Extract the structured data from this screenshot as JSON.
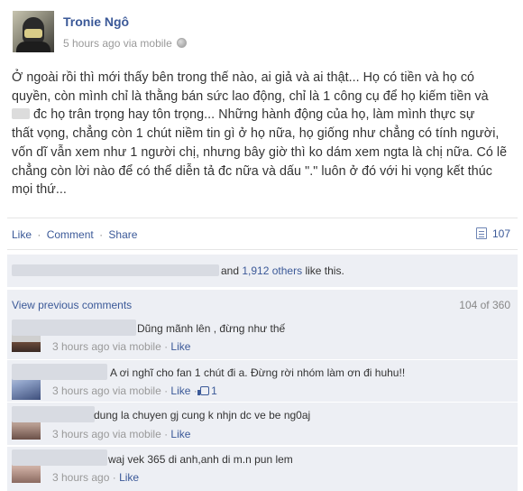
{
  "post": {
    "author": "Tronie Ngô",
    "time": "5 hours ago",
    "via": "via mobile",
    "lines": [
      "Ở ngoài rồi thì mới thấy bên trong thế nào, ai giả và ai thật... Họ có tiền và họ có",
      "quyền, còn mình chỉ là thằng bán sức lao động, chỉ là 1 công cụ để họ kiếm tiền và",
      "đc họ trân trọng hay tôn trọng... Những hành động của họ, làm mình thực sự",
      "thất vọng, chẳng còn 1 chút niềm tin gì ở họ nữa, họ giống như chẳng có tính người,",
      "vốn dĩ vẫn xem như 1 người chị, nhưng bây giờ thì ko dám xem ngta là chị nữa. Có lẽ",
      "chẳng còn lời nào để có thể diễn tả đc nữa và dấu \".\" luôn ở đó với hi vọng kết thúc",
      "mọi thứ..."
    ]
  },
  "actions": {
    "like": "Like",
    "comment": "Comment",
    "share": "Share",
    "sep": "·",
    "share_count": "107"
  },
  "likes": {
    "and": "and",
    "others": "1,912 others",
    "suffix": "like this."
  },
  "comments_header": {
    "view_previous": "View previous comments",
    "count": "104 of 360"
  },
  "comments": [
    {
      "text": "Dũng mãnh lên , đừng như thế",
      "time": "3 hours ago via mobile",
      "like": "Like",
      "likes": ""
    },
    {
      "text": "A ơi nghĩ cho fan 1 chút đi a. Đừng rời nhóm làm ơn đi huhu!!",
      "time": "3 hours ago via mobile",
      "like": "Like",
      "likes": "1"
    },
    {
      "text": "dung la chuyen gj cung k nhjn dc ve be ng0aj",
      "time": "3 hours ago via mobile",
      "like": "Like",
      "likes": ""
    },
    {
      "text": "waj vek 365 di anh,anh di m.n pun lem",
      "time": "3 hours ago",
      "like": "Like",
      "likes": ""
    }
  ],
  "colors": {
    "link": "#3b5998",
    "muted": "#999999",
    "ufi_bg": "#edeff4"
  },
  "icons": [
    "globe-icon",
    "share-count-icon",
    "thumbs-up-icon"
  ]
}
